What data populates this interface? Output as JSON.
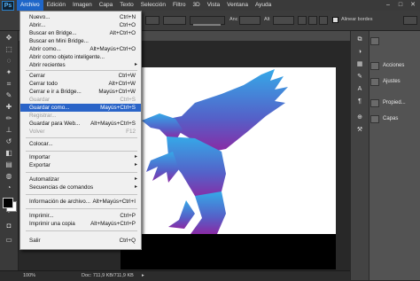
{
  "app": {
    "logo": "Ps"
  },
  "menubar": [
    "Archivo",
    "Edición",
    "Imagen",
    "Capa",
    "Texto",
    "Selección",
    "Filtro",
    "3D",
    "Vista",
    "Ventana",
    "Ayuda"
  ],
  "options": {
    "anc_label": "Anc",
    "alt_label": "Alt",
    "align_label": "Alinear bordes"
  },
  "file_menu": [
    {
      "label": "Nuevo...",
      "shortcut": "Ctrl+N"
    },
    {
      "label": "Abrir...",
      "shortcut": "Ctrl+O"
    },
    {
      "label": "Buscar en Bridge...",
      "shortcut": "Alt+Ctrl+O"
    },
    {
      "label": "Buscar en Mini Bridge...",
      "shortcut": ""
    },
    {
      "label": "Abrir como...",
      "shortcut": "Alt+Mayús+Ctrl+O"
    },
    {
      "label": "Abrir como objeto inteligente...",
      "shortcut": ""
    },
    {
      "label": "Abrir recientes",
      "shortcut": ""
    },
    {
      "label": "Cerrar",
      "shortcut": "Ctrl+W"
    },
    {
      "label": "Cerrar todo",
      "shortcut": "Alt+Ctrl+W"
    },
    {
      "label": "Cerrar e ir a Bridge...",
      "shortcut": "Mayús+Ctrl+W"
    },
    {
      "label": "Guardar",
      "shortcut": "Ctrl+S"
    },
    {
      "label": "Guardar como...",
      "shortcut": "Mayús+Ctrl+S"
    },
    {
      "label": "Registrar...",
      "shortcut": ""
    },
    {
      "label": "Guardar para Web...",
      "shortcut": "Alt+Mayús+Ctrl+S"
    },
    {
      "label": "Volver",
      "shortcut": "F12"
    },
    {
      "label": "Colocar...",
      "shortcut": ""
    },
    {
      "label": "Importar",
      "shortcut": ""
    },
    {
      "label": "Exportar",
      "shortcut": ""
    },
    {
      "label": "Automatizar",
      "shortcut": ""
    },
    {
      "label": "Secuencias de comandos",
      "shortcut": ""
    },
    {
      "label": "Información de archivo...",
      "shortcut": "Alt+Mayús+Ctrl+I"
    },
    {
      "label": "Imprimir...",
      "shortcut": "Ctrl+P"
    },
    {
      "label": "Imprimir una copia",
      "shortcut": "Alt+Mayús+Ctrl+P"
    },
    {
      "label": "Salir",
      "shortcut": "Ctrl+Q"
    }
  ],
  "panels": [
    "Acciones",
    "Ajustes",
    "Propied...",
    "Capas"
  ],
  "status": {
    "zoom": "100%",
    "doc": "Doc: 711,9 KB/711,9 KB"
  },
  "colors": {
    "accent": "#2a64c8",
    "gradient_top": "#35a9e8",
    "gradient_bottom": "#8a2aa4"
  }
}
